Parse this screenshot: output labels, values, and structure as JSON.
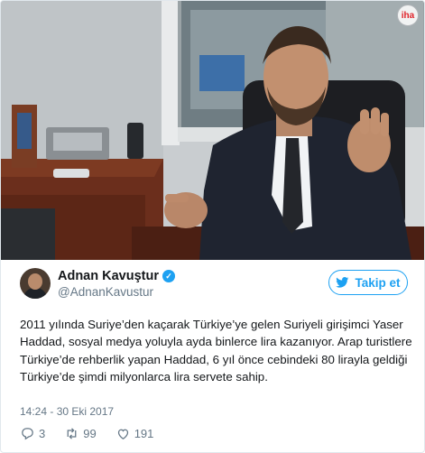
{
  "tweet": {
    "author": {
      "display_name": "Adnan Kavuştur",
      "handle": "@AdnanKavustur",
      "verified": true
    },
    "follow_label": "Takip et",
    "text": "2011 yılında Suriye’den kaçarak Türkiye’ye gelen Suriyeli girişimci Yaser Haddad, sosyal medya yoluyla ayda binlerce lira kazanıyor. Arap turistlere Türkiye’de rehberlik yapan Haddad, 6 yıl önce cebindeki 80 lirayla geldiği Türkiye’de şimdi milyonlarca lira servete sahip.",
    "timestamp": "14:24 - 30 Eki 2017",
    "stats": {
      "replies": "3",
      "retweets": "99",
      "likes": "191"
    }
  },
  "colors": {
    "accent": "#1da1f2",
    "secondary_text": "#657786",
    "primary_text": "#14171a",
    "border": "#e1e8ed"
  },
  "icons": [
    "verified-icon",
    "twitter-bird-icon",
    "reply-icon",
    "retweet-icon",
    "like-icon"
  ]
}
